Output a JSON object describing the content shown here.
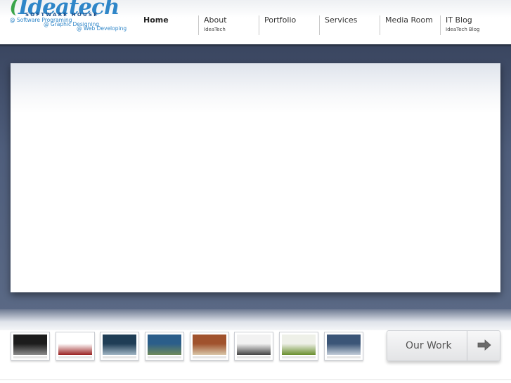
{
  "logo": {
    "name": "Ideatech",
    "subtitle": "SOFTWARE HOUSE",
    "lines": [
      "@ Software Programing",
      "@ Graphic Designing",
      "@ Web Developing"
    ]
  },
  "nav": {
    "items": [
      {
        "label": "Home",
        "sub": ""
      },
      {
        "label": "About",
        "sub": "IdeaTech"
      },
      {
        "label": "Portfolio",
        "sub": ""
      },
      {
        "label": "Services",
        "sub": ""
      },
      {
        "label": "Media Room",
        "sub": ""
      },
      {
        "label": "IT Blog",
        "sub": "IdeaTech Blog"
      }
    ]
  },
  "portfolio": {
    "thumbnails": [
      {
        "name": "thumb-1",
        "colors": [
          "#1c1c1c",
          "#8a8a8a"
        ]
      },
      {
        "name": "thumb-2",
        "colors": [
          "#ffffff",
          "#9a2222"
        ]
      },
      {
        "name": "thumb-3",
        "colors": [
          "#1f3d55",
          "#9fb4c3"
        ]
      },
      {
        "name": "thumb-4",
        "colors": [
          "#2b5e8a",
          "#6f8a5a"
        ]
      },
      {
        "name": "thumb-5",
        "colors": [
          "#a0522d",
          "#d9c5a7"
        ]
      },
      {
        "name": "thumb-6",
        "colors": [
          "#f2f2f2",
          "#444444"
        ]
      },
      {
        "name": "thumb-7",
        "colors": [
          "#eef0e8",
          "#6a8f2e"
        ]
      },
      {
        "name": "thumb-8",
        "colors": [
          "#3b5577",
          "#c2ccd8"
        ]
      }
    ],
    "our_work_label": "Our Work",
    "arrow_icon": "right-arrow-icon"
  },
  "colors": {
    "band": "#4f5e7c",
    "logo_blue": "#2f86c8",
    "logo_green": "#3aa54a"
  }
}
